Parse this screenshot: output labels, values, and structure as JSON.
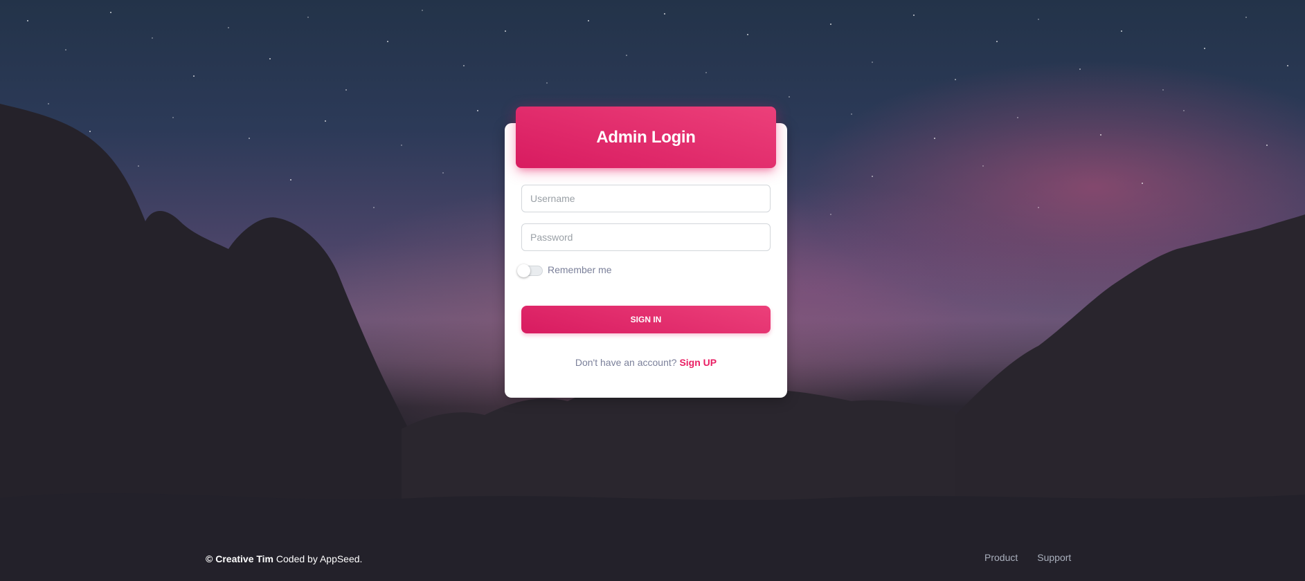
{
  "login": {
    "title": "Admin Login",
    "username_placeholder": "Username",
    "password_placeholder": "Password",
    "remember_label": "Remember me",
    "remember_checked": false,
    "signin_label": "SIGN IN",
    "signup_prompt": "Don't have an account?",
    "signup_link": "Sign UP"
  },
  "footer": {
    "copyright_symbol": "©",
    "brand": "Creative Tim",
    "coded_by": "Coded by AppSeed.",
    "links": [
      "Product",
      "Support"
    ]
  },
  "colors": {
    "accent": "#e91e63",
    "accent_gradient_start": "#ec407a",
    "accent_gradient_end": "#d81b60",
    "muted_text": "#7b809a"
  },
  "icons": [
    "toggle-switch"
  ]
}
